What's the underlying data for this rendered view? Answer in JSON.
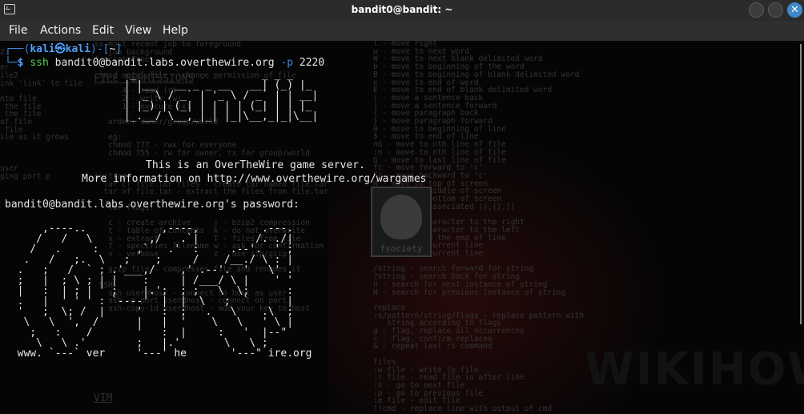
{
  "window": {
    "title": "bandit0@bandit: ~",
    "app_icon": "terminal-icon",
    "buttons": [
      "minimize",
      "maximize",
      "close"
    ],
    "close_glyph": "✕"
  },
  "menu": [
    "File",
    "Actions",
    "Edit",
    "View",
    "Help"
  ],
  "prompt": {
    "user": "kali",
    "at_symbol": "㉿",
    "host": "kali",
    "dir": "~",
    "command": "ssh",
    "args": "bandit0@bandit.labs.overthewire.org",
    "flag": "-p",
    "port": "2220"
  },
  "banner_lines": [
    "                    _                    _ _ _",
    "                   | |__   __ _ _ __   __| (_) |_",
    "                   | '_ \\ / _` | '_ \\ / _` | | __|",
    "                   | |_) | (_| | | | | (_| | | |_",
    "                   |_.__/ \\__,_|_| |_|\\__,_|_|\\__|"
  ],
  "info_line1": "This is an OverTheWire game server.",
  "info_line2": "More information on http://www.overthewire.org/wargames",
  "password_prompt": "bandit0@bandit.labs.overthewire.org's password:",
  "big_art": [
    "      ,----..            ,----,          .---.",
    "     /   /   \\         ,/   .`|         /. ./|",
    "    /   .     :      ,`   .'  :     .--'.  ' ;",
    "   .   /   ;.  \\   ;    ;     /    /__./ \\ : |",
    "  .   ;   /  ` ; .'___,/    ,' .--'.  '   \\' .",
    "  ;   |  ; \\ ; | |    :     | /___/ \\ |    ' '",
    "  |   :  | ; | ' ;    |.';  ; ;   \\  \\;      :",
    "  .   |  ' ' ' : `----'  |  |  \\   ;  `      |",
    "  '   ;  \\; /  |     '   :  ;   .   \\    .\\  ;",
    "   \\   \\  ',  /      |   |  '    \\   \\   ' \\ |",
    "    ;   :    /       '   :  |     :   '  |--\"",
    "     \\   \\ .'        ;   |.'       \\   \\ ;",
    "  www. `---` ver     '---' he       '---\" ire.org"
  ],
  "background": {
    "heading1": "FILE PERMISSIONS",
    "heading2": "VIM",
    "logo_caption": "fsociety",
    "watermark": "WIKIHOW",
    "left_column": "ss most recent job to foreground\n   job background\nfsocietyFsoc\n\nchmod octal file - change permission of file\n\n      4 - read (r)\n      2 - write (w)\n      1 - execute (x)\n\n   order: owner/group/world\n\n   eg:\n   chmod 777 - rwx for everyone\n   chmod 755 - rw for owner, rx for group/world\n\n\nsorting\n  tar cf file.tar files - create tar named file.tar\n  tar xf file.tar - extract the files from file.tar\n\n   tar flags:\n\n   c - create archive     j - bzip2 compression\n   t - table of contents  k - do not overwrite\n   x - extract            T - files from file\n   f - specifies filename w - ask for confirmation\n   v - verbose            z - use zip/gzip\n\n   gzip file - compresses file and renames it\n\n SSH\n   ssh user@host - connect to host as user\n   ssh -p port user@host - connect on port\n   ssh-copy-id user@host - add your key to host\n\n\n",
    "right_column": "l - move right\nw - move to next word\nW - move to next blank delimited word\nb - move to beginning of the word\nB - move to beginning of blank delimited word\ne - move to end of word\nE - move to end of blank delimited word\n( - move a sentence back\n) - move a sentence forward\n{ - move paragraph back\n} - move paragraph forward\n0 - move to beginning of line\n$ - move to end of line\nnG - move to nth line of file\n:n - move to nth line of file\nG - move to last line of file\nfc - move forward to 'c'\nFc - move backward to 'c'\nH - move to top of screen\nM - move to middle of screen\nL - move to bottom of screen\n% - move to associated (),{},[]\n\nx - delete character to the right\nX - delete character to the left\nD - delete to the end of line\ndd - delete current line\n:d - delete current line\n\n/string - search forward for string\n?string - search back for string\nn - search for next instance of string\nN - search for previous instance of string\n\nreplace\n:s/pattern/string/flags - replace pattern with\n   string according to flags\ng - flag, replace all occurrences\nc - flag, confirm replaces\n& - repeat last :s command\n\nfiles\n:w file - write to file\n:r file - read file in after line\n:n - go to next file\n:p - go to previous file\n:e file - edit file\n!!cmd - replace line with output of cmd",
    "far_left": "   \n2:  \n\ner\nile2\nink 'link' to file\n\nnto file\n the file\n the file\nof file\n file\nile as it grows\n\n\n\nuser\nging port p\n"
  }
}
